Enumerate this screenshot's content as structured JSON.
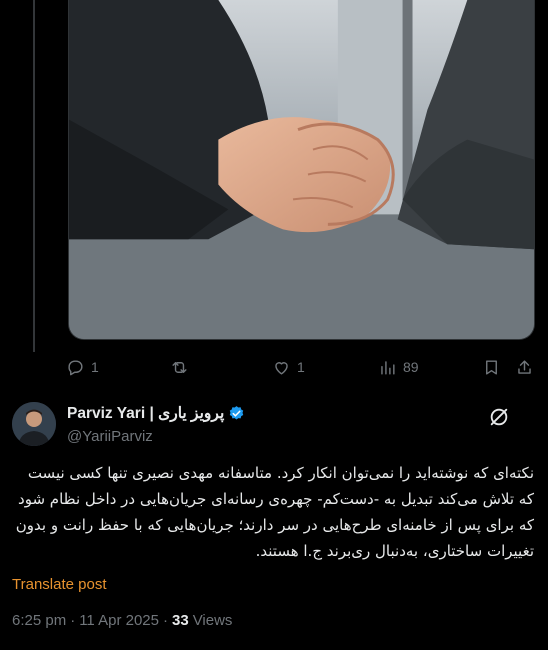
{
  "post_actions": {
    "reply_count": "1",
    "like_count": "1",
    "views_count": "89"
  },
  "author": {
    "display_name": "Parviz Yari | پرویز یاری",
    "handle": "@YariiParviz"
  },
  "tweet": {
    "text": "نکته‌ای که نوشته‌اید را نمی‌توان انکار کرد. متاسفانه مهدی نصیری تنها کسی نیست که تلاش می‌کند تبدیل به -دست‌کم- چهره‌ی رسانه‌ای جریان‌هایی در داخل نظام شود که برای پس از خامنه‌ای طرح‌هایی در سر دارند؛ جریان‌هایی که با حفظ رانت و بدون تغییرات ساختاری، به‌دنبال ری‌برند ج.ا هستند.",
    "translate_label": "Translate post",
    "time": "6:25 pm",
    "date": "11 Apr 2025",
    "separator": "·",
    "views_count": "33",
    "views_label": "Views"
  },
  "colors": {
    "accent": "#e8932f",
    "verified": "#1d9bf0",
    "muted": "#71767b"
  },
  "icons": [
    "reply-icon",
    "repost-icon",
    "like-icon",
    "views-icon",
    "bookmark-icon",
    "share-icon",
    "verified-badge-icon",
    "grok-icon"
  ]
}
